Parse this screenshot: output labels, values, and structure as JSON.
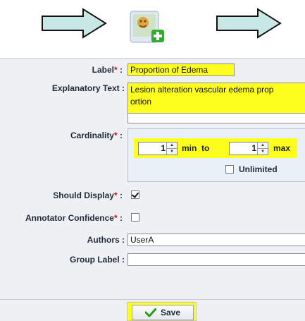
{
  "form": {
    "label": {
      "caption": "Label",
      "value": "Proportion of Edema"
    },
    "explanatory": {
      "caption": "Explanatory Text :",
      "value_line1": "Lesion alteration vascular edema prop",
      "value_line2": "ortion"
    },
    "cardinality": {
      "caption": "Cardinality",
      "min": "1",
      "min_to": "min  to",
      "max": "1",
      "max_label": "max",
      "unlimited_label": "Unlimited"
    },
    "should_display": {
      "caption": "Should Display",
      "checked": true
    },
    "annotator_confidence": {
      "caption": "Annotator Confidence",
      "checked": false
    },
    "authors": {
      "caption": "Authors :",
      "value": "UserA"
    },
    "group_label": {
      "caption": "Group Label :",
      "value": ""
    },
    "required_mark": "*",
    "colon": ":"
  },
  "save_button": {
    "label": "Save"
  },
  "colors": {
    "highlight": "#ffff1e",
    "panel": "#eef0f4",
    "arrow_fill": "#c8e8e6"
  },
  "icons": [
    "right-arrow-icon",
    "add-template-icon",
    "right-arrow-icon",
    "spinner-up-icon",
    "spinner-down-icon",
    "checkmark-icon"
  ]
}
